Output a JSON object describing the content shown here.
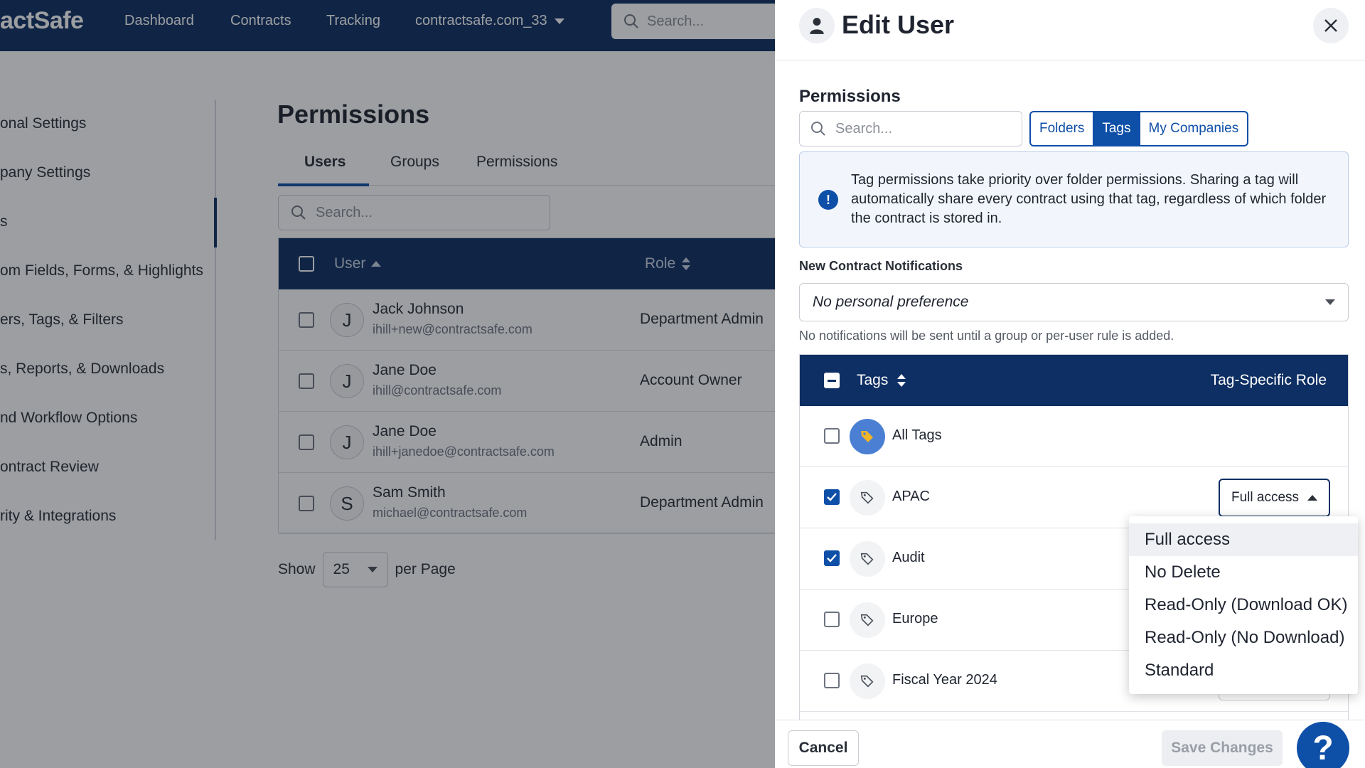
{
  "app": {
    "logo": "actSafe",
    "nav": [
      "Dashboard",
      "Contracts",
      "Tracking"
    ],
    "company": "contractsafe.com_33",
    "search_placeholder": "Search..."
  },
  "sidebar": {
    "items": [
      "onal Settings",
      "pany Settings",
      "s",
      "om Fields, Forms, & Highlights",
      "ers, Tags, & Filters",
      "s, Reports, & Downloads",
      "nd Workflow Options",
      "ontract Review",
      "rity & Integrations"
    ]
  },
  "main": {
    "title": "Permissions",
    "tabs": [
      "Users",
      "Groups",
      "Permissions"
    ],
    "search_placeholder": "Search...",
    "columns": [
      "User",
      "Role"
    ],
    "users": [
      {
        "initial": "J",
        "name": "Jack Johnson",
        "email": "ihill+new@contractsafe.com",
        "role": "Department Admin"
      },
      {
        "initial": "J",
        "name": "Jane Doe",
        "email": "ihill@contractsafe.com",
        "role": "Account Owner"
      },
      {
        "initial": "J",
        "name": "Jane Doe",
        "email": "ihill+janedoe@contractsafe.com",
        "role": "Admin"
      },
      {
        "initial": "S",
        "name": "Sam Smith",
        "email": "michael@contractsafe.com",
        "role": "Department Admin"
      }
    ],
    "show_label": "Show",
    "per_page_value": "25",
    "per_page_label": "per Page"
  },
  "edit_user": {
    "title": "Edit User",
    "permissions_title": "Permissions",
    "search_placeholder": "Search...",
    "segments": [
      "Folders",
      "Tags",
      "My Companies"
    ],
    "active_segment": "Tags",
    "info_text": "Tag permissions take priority over folder permissions. Sharing a tag will automatically share every contract using that tag, regardless of which folder the contract is stored in.",
    "notifications_label": "New Contract Notifications",
    "notifications_value": "No personal preference",
    "notifications_hint": "No notifications will be sent until a group or per-user rule is added.",
    "tags_header": "Tags",
    "role_header": "Tag-Specific Role",
    "tags": [
      {
        "name": "All Tags",
        "checked": false
      },
      {
        "name": "APAC",
        "checked": true,
        "role": "Full access"
      },
      {
        "name": "Audit",
        "checked": true
      },
      {
        "name": "Europe",
        "checked": false
      },
      {
        "name": "Fiscal Year 2024",
        "checked": false
      }
    ],
    "role_options": [
      "Full access",
      "No Delete",
      "Read-Only (Download OK)",
      "Read-Only (No Download)",
      "Standard"
    ],
    "cancel_label": "Cancel",
    "save_label": "Save Changes",
    "help_label": "?"
  },
  "colors": {
    "navy": "#0e2f63",
    "primary": "#0e4fa8",
    "tag_all_bg": "#4a7fd4",
    "tag_all_icon": "#f0b428"
  }
}
